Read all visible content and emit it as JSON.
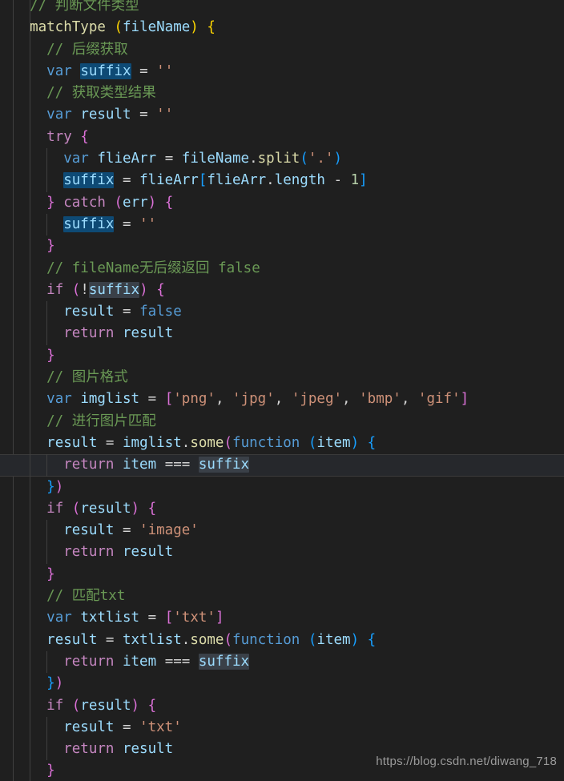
{
  "editor": {
    "language": "javascript",
    "theme": "dark-plus",
    "background_color": "#1f1f1f",
    "selection_color": "#0e4a75",
    "occurrence_highlight_color": "#3a4048",
    "current_line_color": "#26282c",
    "selected_word": "suffix",
    "current_line_number": 21
  },
  "code_lines": [
    {
      "id": "l1",
      "text": "  // 判断文件类型"
    },
    {
      "id": "l2",
      "text": "  matchType (fileName) {"
    },
    {
      "id": "l3",
      "text": "    // 后缀获取"
    },
    {
      "id": "l4",
      "text": "    var suffix = ''"
    },
    {
      "id": "l5",
      "text": "    // 获取类型结果"
    },
    {
      "id": "l6",
      "text": "    var result = ''"
    },
    {
      "id": "l7",
      "text": "    try {"
    },
    {
      "id": "l8",
      "text": "      var flieArr = fileName.split('.')"
    },
    {
      "id": "l9",
      "text": "      suffix = flieArr[flieArr.length - 1]"
    },
    {
      "id": "l10",
      "text": "    } catch (err) {"
    },
    {
      "id": "l11",
      "text": "      suffix = ''"
    },
    {
      "id": "l12",
      "text": "    }"
    },
    {
      "id": "l13",
      "text": "    // fileName无后缀返回 false"
    },
    {
      "id": "l14",
      "text": "    if (!suffix) {"
    },
    {
      "id": "l15",
      "text": "      result = false"
    },
    {
      "id": "l16",
      "text": "      return result"
    },
    {
      "id": "l17",
      "text": "    }"
    },
    {
      "id": "l18",
      "text": "    // 图片格式"
    },
    {
      "id": "l19",
      "text": "    var imglist = ['png', 'jpg', 'jpeg', 'bmp', 'gif']"
    },
    {
      "id": "l20",
      "text": "    // 进行图片匹配"
    },
    {
      "id": "l21",
      "text": "    result = imglist.some(function (item) {"
    },
    {
      "id": "l22",
      "text": "      return item === suffix"
    },
    {
      "id": "l23",
      "text": "    })"
    },
    {
      "id": "l24",
      "text": "    if (result) {"
    },
    {
      "id": "l25",
      "text": "      result = 'image'"
    },
    {
      "id": "l26",
      "text": "      return result"
    },
    {
      "id": "l27",
      "text": "    }"
    },
    {
      "id": "l28",
      "text": "    // 匹配txt"
    },
    {
      "id": "l29",
      "text": "    var txtlist = ['txt']"
    },
    {
      "id": "l30",
      "text": "    result = txtlist.some(function (item) {"
    },
    {
      "id": "l31",
      "text": "      return item === suffix"
    },
    {
      "id": "l32",
      "text": "    })"
    },
    {
      "id": "l33",
      "text": "    if (result) {"
    },
    {
      "id": "l34",
      "text": "      result = 'txt'"
    },
    {
      "id": "l35",
      "text": "      return result"
    },
    {
      "id": "l36",
      "text": "    }"
    }
  ],
  "watermark": {
    "url": "https://blog.csdn.net/diwang_718"
  }
}
